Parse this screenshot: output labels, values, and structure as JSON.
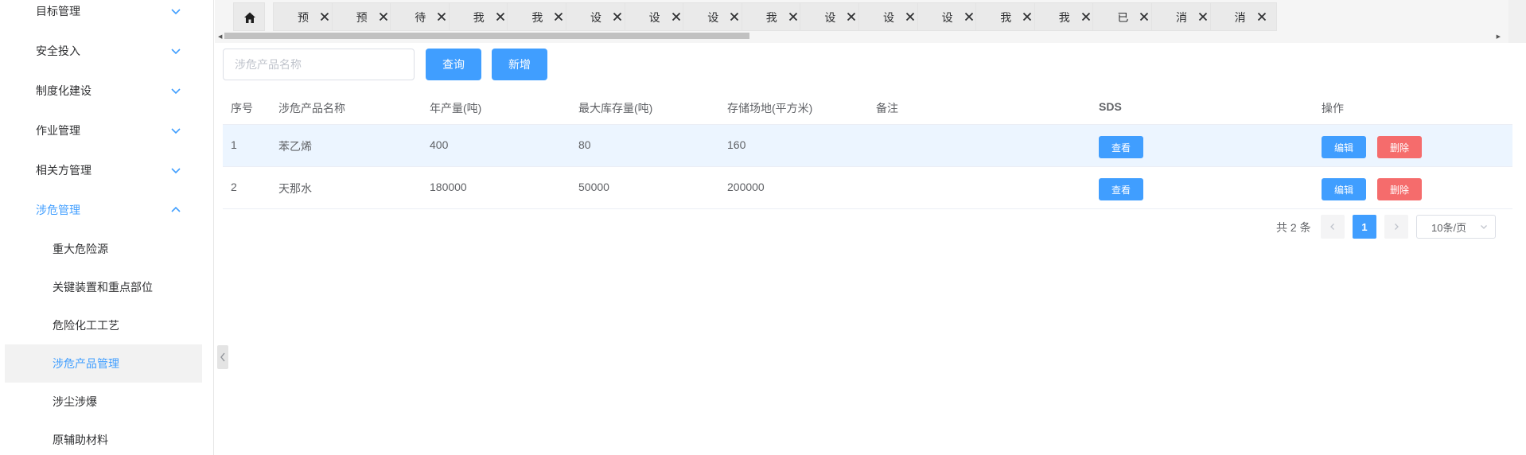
{
  "sidebar": {
    "items": [
      {
        "label": "目标管理"
      },
      {
        "label": "安全投入"
      },
      {
        "label": "制度化建设"
      },
      {
        "label": "作业管理"
      },
      {
        "label": "相关方管理"
      },
      {
        "label": "涉危管理"
      }
    ],
    "sub_items": [
      {
        "label": "重大危险源"
      },
      {
        "label": "关键装置和重点部位"
      },
      {
        "label": "危险化工工艺"
      },
      {
        "label": "涉危产品管理"
      },
      {
        "label": "涉尘涉爆"
      },
      {
        "label": "原辅助材料"
      }
    ],
    "accent_color": "#409eff"
  },
  "tabs": [
    {
      "label": "预"
    },
    {
      "label": "预"
    },
    {
      "label": "待"
    },
    {
      "label": "我"
    },
    {
      "label": "我"
    },
    {
      "label": "设"
    },
    {
      "label": "设"
    },
    {
      "label": "设"
    },
    {
      "label": "我"
    },
    {
      "label": "设"
    },
    {
      "label": "设"
    },
    {
      "label": "设"
    },
    {
      "label": "我"
    },
    {
      "label": "我"
    },
    {
      "label": "已"
    },
    {
      "label": "消"
    },
    {
      "label": "消"
    }
  ],
  "toolbar": {
    "search_placeholder": "涉危产品名称",
    "query_label": "查询",
    "add_label": "新增"
  },
  "table": {
    "headers": [
      "序号",
      "涉危产品名称",
      "年产量(吨)",
      "最大库存量(吨)",
      "存储场地(平方米)",
      "备注",
      "SDS",
      "操作"
    ],
    "rows": [
      {
        "no": "1",
        "name": "苯乙烯",
        "annual": "400",
        "max_stock": "80",
        "area": "160",
        "remark": ""
      },
      {
        "no": "2",
        "name": "天那水",
        "annual": "180000",
        "max_stock": "50000",
        "area": "200000",
        "remark": ""
      }
    ],
    "view_label": "查看",
    "edit_label": "编辑",
    "delete_label": "删除"
  },
  "pagination": {
    "total_text": "共 2 条",
    "current_page": "1",
    "page_size": "10条/页"
  }
}
